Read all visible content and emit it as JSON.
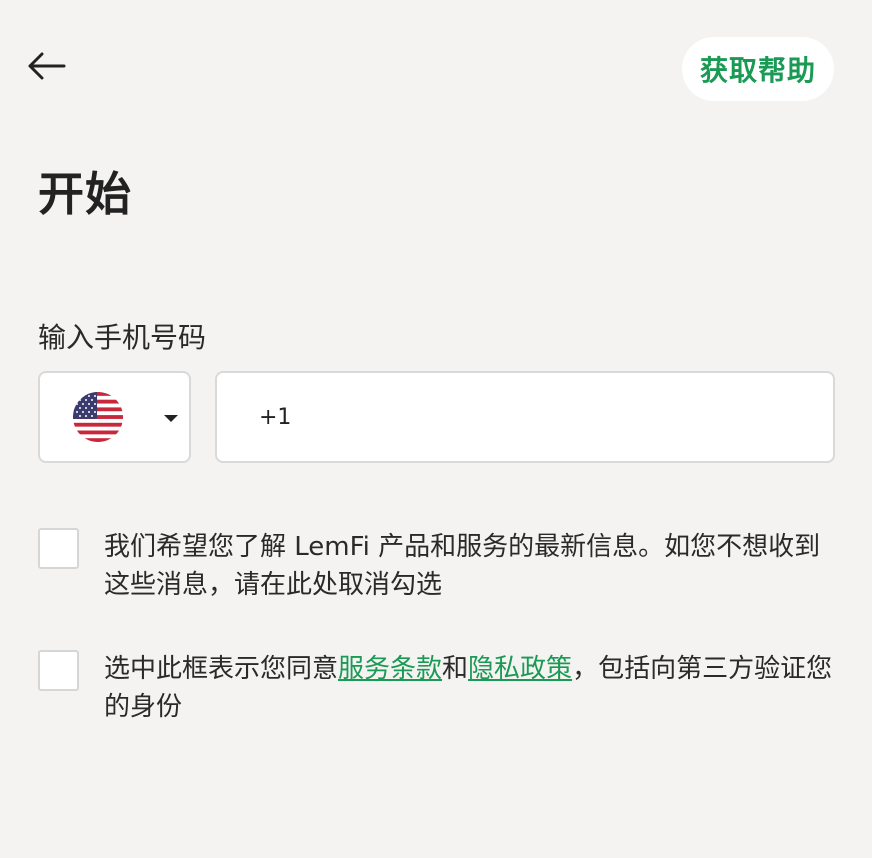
{
  "header": {
    "back_icon": "arrow-left-icon",
    "help_label": "获取帮助"
  },
  "title": "开始",
  "phone": {
    "label": "输入手机号码",
    "country": "US",
    "flag_icon": "us-flag-icon",
    "value": "+1"
  },
  "consent_marketing": {
    "text": "我们希望您了解 LemFi 产品和服务的最新信息。如您不想收到这些消息，请在此处取消勾选",
    "checked": false
  },
  "consent_terms": {
    "text_before": "选中此框表示您同意",
    "terms_link": "服务条款",
    "text_and": "和",
    "privacy_link": "隐私政策",
    "text_after": "，包括向第三方验证您的身份",
    "checked": false
  },
  "colors": {
    "accent": "#1a9a55",
    "background": "#f4f3f2"
  }
}
